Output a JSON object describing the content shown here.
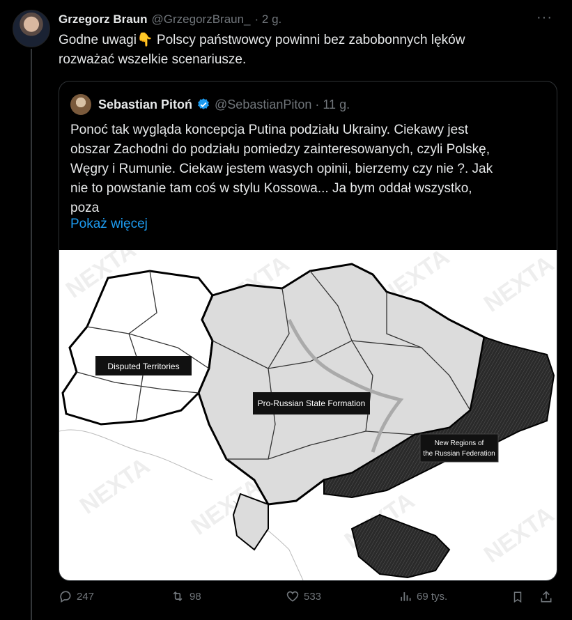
{
  "tweet": {
    "author_name": "Grzegorz Braun",
    "author_handle": "@GrzegorzBraun_",
    "time": "· 2 g.",
    "more": "···",
    "text_line1": "Godne uwagi👇 Polscy państwowcy powinni bez zabobonnych lęków",
    "text_line2": "rozważać wszelkie scenariusze."
  },
  "quote": {
    "author_name": "Sebastian Pitoń",
    "author_handle": "@SebastianPiton",
    "time": "· 11 g.",
    "text_lines": [
      "Ponoć tak wygląda koncepcja Putina podziału Ukrainy. Ciekawy jest",
      "obszar Zachodni do podziału pomiedzy zainteresowanych, czyli Polskę,",
      "Węgry i Rumunie. Ciekaw jestem wasych opinii, bierzemy czy nie ?. Jak",
      "nie to powstanie tam coś w stylu Kossowa... Ja bym oddał wszystko,",
      "poza"
    ],
    "show_more": "Pokaż więcej",
    "map": {
      "label_disputed": "Disputed Territories",
      "label_pro_russian": "Pro-Russian State Formation",
      "label_new_regions_1": "New Regions of",
      "label_new_regions_2": "the Russian Federation",
      "watermark": "NEXTA"
    }
  },
  "actions": {
    "replies": "247",
    "reposts": "98",
    "likes": "533",
    "views": "69 tys.",
    "icons": [
      "reply-icon",
      "repost-icon",
      "like-icon",
      "views-icon",
      "bookmark-icon",
      "share-icon"
    ]
  }
}
